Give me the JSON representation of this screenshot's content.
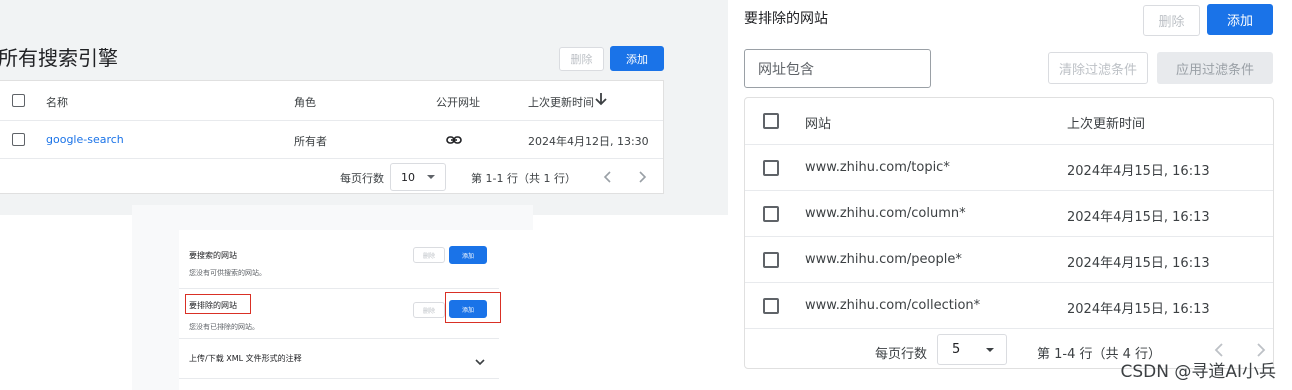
{
  "left_top": {
    "title": "所有搜索引擎",
    "delete_label": "删除",
    "add_label": "添加",
    "columns": [
      "名称",
      "角色",
      "公开网址",
      "上次更新时间"
    ],
    "rows": [
      {
        "name": "google-search",
        "role": "所有者",
        "public_url_icon": "link-icon",
        "updated": "2024年4月12日, 13:30"
      }
    ],
    "pagination": {
      "rows_per_page_label": "每页行数",
      "rows_per_page": "10",
      "range": "第 1-1 行（共 1 行）"
    }
  },
  "left_bottom": {
    "sections": [
      {
        "title": "要搜索的网站",
        "subtitle": "您没有可供搜索的网站。",
        "delete_label": "删除",
        "add_label": "添加"
      },
      {
        "title": "要排除的网站",
        "subtitle": "您没有已排除的网站。",
        "delete_label": "删除",
        "add_label": "添加"
      }
    ],
    "xml_label": "上传/下载 XML 文件形式的注释"
  },
  "right": {
    "title": "要排除的网站",
    "delete_label": "删除",
    "add_label": "添加",
    "filter_placeholder": "网址包含",
    "clear_filter_label": "清除过滤条件",
    "apply_filter_label": "应用过滤条件",
    "columns": [
      "网站",
      "上次更新时间"
    ],
    "rows": [
      {
        "site": "www.zhihu.com/topic*",
        "updated": "2024年4月15日, 16:13"
      },
      {
        "site": "www.zhihu.com/column*",
        "updated": "2024年4月15日, 16:13"
      },
      {
        "site": "www.zhihu.com/people*",
        "updated": "2024年4月15日, 16:13"
      },
      {
        "site": "www.zhihu.com/collection*",
        "updated": "2024年4月15日, 16:13"
      }
    ],
    "pagination": {
      "rows_per_page_label": "每页行数",
      "rows_per_page": "5",
      "range": "第 1-4 行（共 4 行）"
    }
  },
  "watermark": "CSDN @寻道AI小兵",
  "colors": {
    "accent": "#1a73e8",
    "highlight_box": "#d93025"
  }
}
